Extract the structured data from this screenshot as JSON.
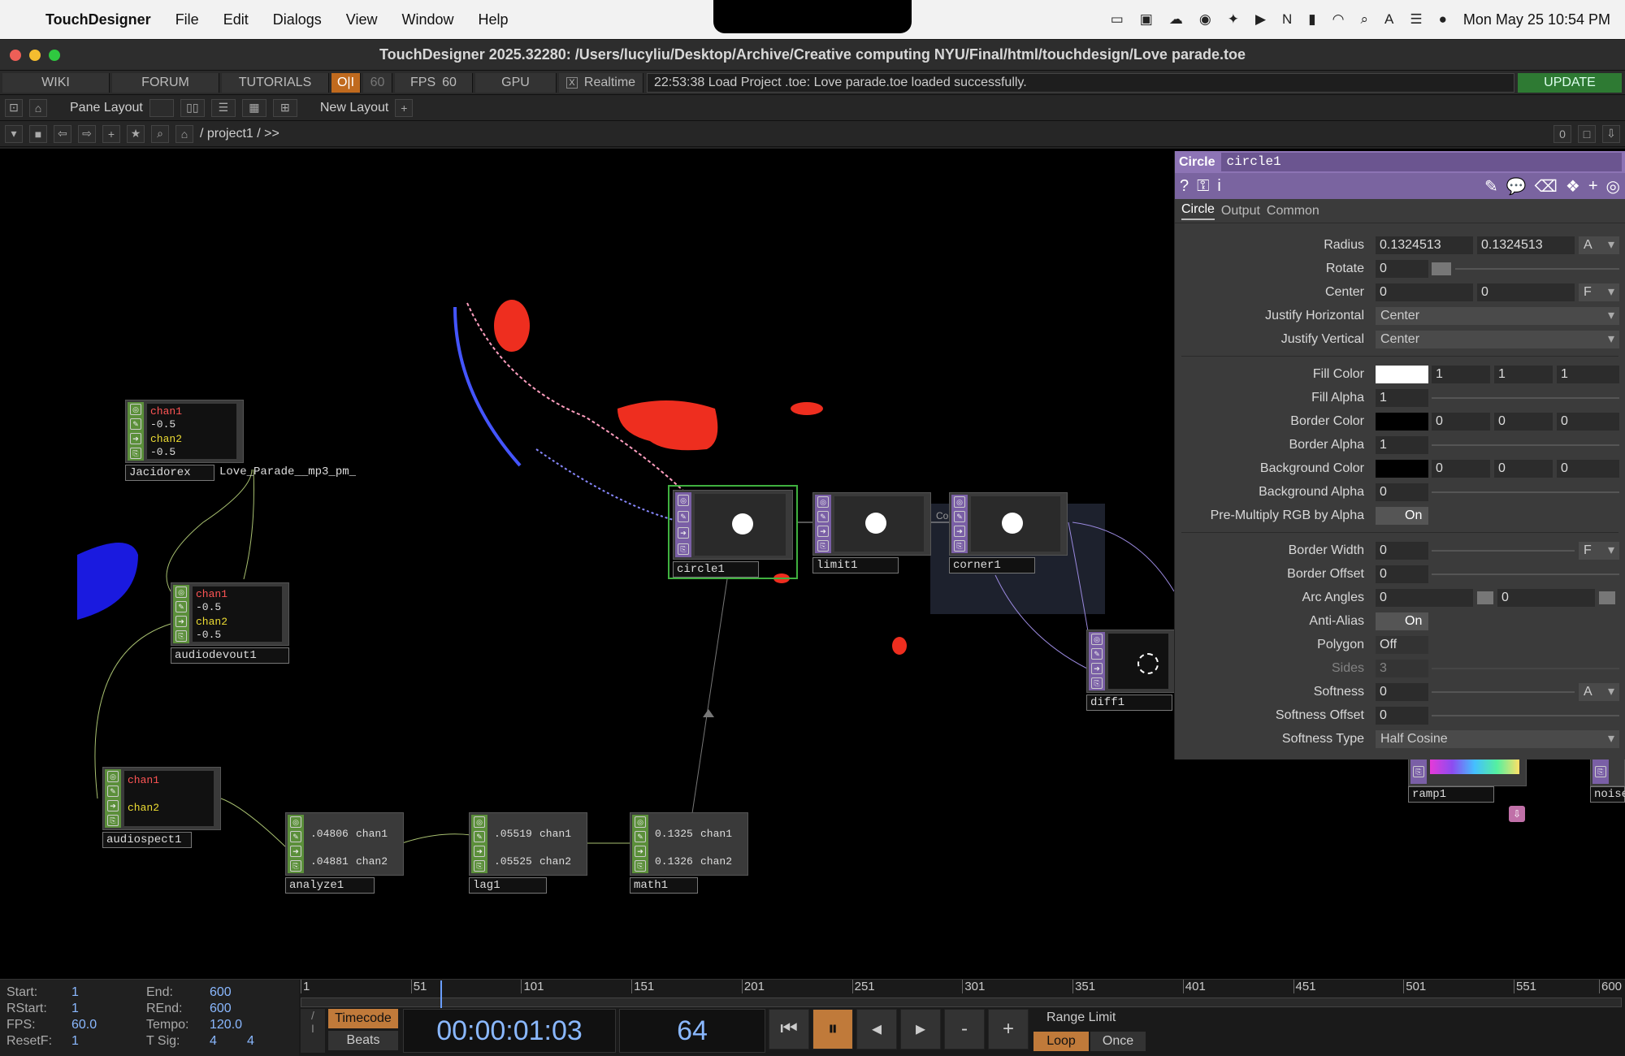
{
  "menubar": {
    "app": "TouchDesigner",
    "items": [
      "File",
      "Edit",
      "Dialogs",
      "View",
      "Window",
      "Help"
    ],
    "datetime": "Mon May 25  10:54 PM"
  },
  "window": {
    "title": "TouchDesigner 2025.32280: /Users/lucyliu/Desktop/Archive/Creative computing NYU/Final/html/touchdesign/Love parade.toe"
  },
  "toolbar": {
    "wiki": "WIKI",
    "forum": "FORUM",
    "tutorials": "TUTORIALS",
    "oi": "O|I",
    "fps_cap": "60",
    "fps_label": "FPS",
    "fps": "60",
    "gpu": "GPU",
    "realtime_check": "X",
    "realtime": "Realtime",
    "log": "22:53:38 Load Project .toe: Love parade.toe loaded successfully.",
    "update": "UPDATE"
  },
  "layout": {
    "pane_layout": "Pane Layout",
    "new_layout": "New Layout",
    "plus": "+"
  },
  "path": {
    "text": "/ project1 / >>",
    "count": "0"
  },
  "nodes": {
    "jacidorex": "Jacidorex",
    "jac_file": "Love_Parade__mp3_pm_",
    "audiodevout": "audiodevout1",
    "audiospect": "audiospect1",
    "analyze": "analyze1",
    "lag": "lag1",
    "math": "math1",
    "circle": "circle1",
    "limit": "limit1",
    "corner": "corner1",
    "diff": "diff1",
    "ramp": "ramp1",
    "noise": "noise",
    "chan1": "chan1",
    "chan2": "chan2",
    "neg": "-0.5",
    "analyze_v1": ".04806",
    "analyze_v2": ".04881",
    "lag_v1": ".05519",
    "lag_v2": ".05525",
    "math_v1": "0.1325",
    "math_v2": "0.1326",
    "comment": "Co"
  },
  "panel": {
    "type": "Circle",
    "name": "circle1",
    "tabs": [
      "Circle",
      "Output",
      "Common"
    ],
    "params": {
      "radius": {
        "label": "Radius",
        "v1": "0.1324513",
        "v2": "0.1324513",
        "mode": "A"
      },
      "rotate": {
        "label": "Rotate",
        "v": "0"
      },
      "center": {
        "label": "Center",
        "v1": "0",
        "v2": "0",
        "mode": "F"
      },
      "jh": {
        "label": "Justify Horizontal",
        "v": "Center"
      },
      "jv": {
        "label": "Justify Vertical",
        "v": "Center"
      },
      "fillcolor": {
        "label": "Fill Color",
        "r": "1",
        "g": "1",
        "b": "1",
        "swatch": "#ffffff"
      },
      "fillalpha": {
        "label": "Fill Alpha",
        "v": "1"
      },
      "bordercolor": {
        "label": "Border Color",
        "r": "0",
        "g": "0",
        "b": "0",
        "swatch": "#000000"
      },
      "borderalpha": {
        "label": "Border Alpha",
        "v": "1"
      },
      "bgcolor": {
        "label": "Background Color",
        "r": "0",
        "g": "0",
        "b": "0",
        "swatch": "#000000"
      },
      "bgalpha": {
        "label": "Background Alpha",
        "v": "0"
      },
      "premult": {
        "label": "Pre-Multiply RGB by Alpha",
        "v": "On"
      },
      "borderwidth": {
        "label": "Border Width",
        "v": "0",
        "mode": "F"
      },
      "borderoffset": {
        "label": "Border Offset",
        "v": "0"
      },
      "arc": {
        "label": "Arc Angles",
        "v1": "0",
        "v2": "0"
      },
      "aa": {
        "label": "Anti-Alias",
        "v": "On"
      },
      "polygon": {
        "label": "Polygon",
        "v": "Off"
      },
      "sides": {
        "label": "Sides",
        "v": "3"
      },
      "softness": {
        "label": "Softness",
        "v": "0",
        "mode": "A"
      },
      "softoffset": {
        "label": "Softness Offset",
        "v": "0"
      },
      "softtype": {
        "label": "Softness Type",
        "v": "Half Cosine"
      }
    }
  },
  "stats": {
    "start_k": "Start:",
    "start": "1",
    "end_k": "End:",
    "end": "600",
    "rstart_k": "RStart:",
    "rstart": "1",
    "rend_k": "REnd:",
    "rend": "600",
    "fps_k": "FPS:",
    "fps": "60.0",
    "tempo_k": "Tempo:",
    "tempo": "120.0",
    "resetf_k": "ResetF:",
    "resetf": "1",
    "tsig_k": "T Sig:",
    "tsig1": "4",
    "tsig2": "4"
  },
  "timeline": {
    "ticks": [
      "1",
      "51",
      "101",
      "151",
      "201",
      "251",
      "301",
      "351",
      "401",
      "451",
      "501",
      "551",
      "600"
    ],
    "playhead_frame": 64,
    "timecode_btn": "Timecode",
    "beats_btn": "Beats",
    "timecode": "00:00:01:03",
    "frame": "64",
    "range_limit": "Range Limit",
    "loop": "Loop",
    "once": "Once"
  }
}
